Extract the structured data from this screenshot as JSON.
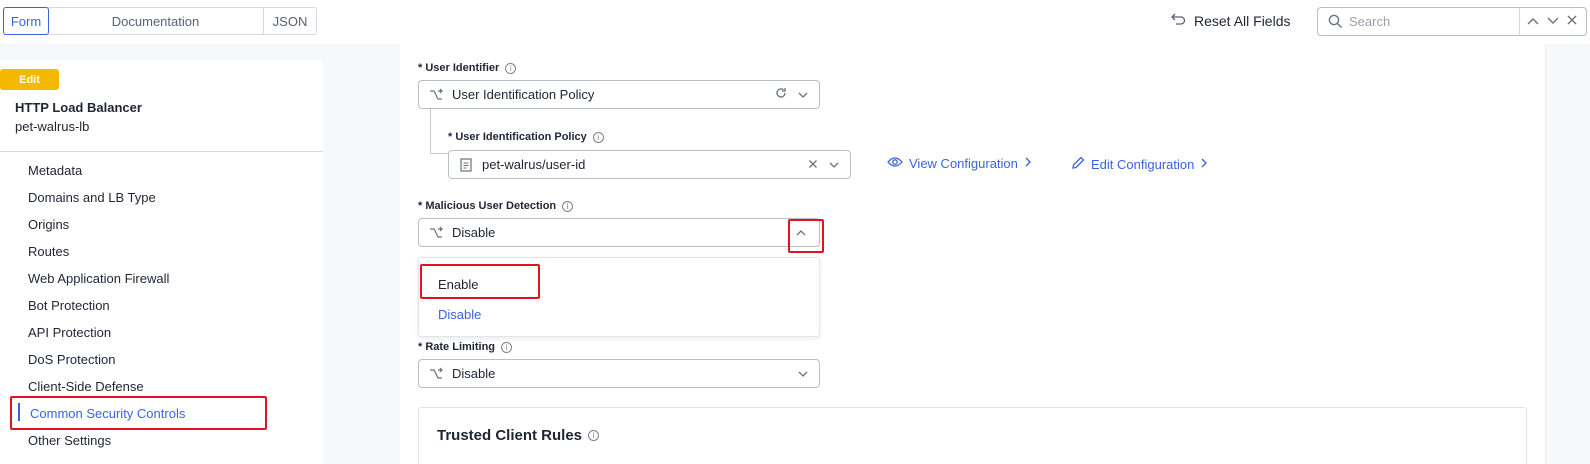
{
  "topbar": {
    "tabs": [
      "Form",
      "Documentation",
      "JSON"
    ],
    "active_tab": "Form",
    "reset_label": "Reset All Fields",
    "search_placeholder": "Search"
  },
  "sidebar": {
    "badge": "Edit",
    "title": "HTTP Load Balancer",
    "subtitle": "pet-walrus-lb",
    "items": [
      "Metadata",
      "Domains and LB Type",
      "Origins",
      "Routes",
      "Web Application Firewall",
      "Bot Protection",
      "API Protection",
      "DoS Protection",
      "Client-Side Defense",
      "Common Security Controls",
      "Other Settings"
    ],
    "active_item": "Common Security Controls"
  },
  "form": {
    "user_identifier": {
      "label": "* User Identifier",
      "value": "User Identification Policy"
    },
    "user_identification_policy": {
      "label": "* User Identification Policy",
      "value": "pet-walrus/user-id",
      "view_link": "View Configuration",
      "edit_link": "Edit Configuration"
    },
    "malicious_user_detection": {
      "label": "* Malicious User Detection",
      "value": "Disable",
      "options": [
        "Enable",
        "Disable"
      ],
      "selected_option": "Disable",
      "expanded": true
    },
    "rate_limiting": {
      "label": "* Rate Limiting",
      "value": "Disable"
    },
    "trusted_client_rules": {
      "title": "Trusted Client Rules"
    }
  },
  "colors": {
    "accent": "#3b63e0",
    "badge": "#f5b800",
    "highlight": "#e0141e"
  },
  "icons": {
    "reset": "undo-icon",
    "search": "search-icon",
    "choice": "branch-choice-icon",
    "refresh": "refresh-icon",
    "clear": "close-icon",
    "eye": "eye-icon",
    "pencil": "pencil-icon"
  }
}
